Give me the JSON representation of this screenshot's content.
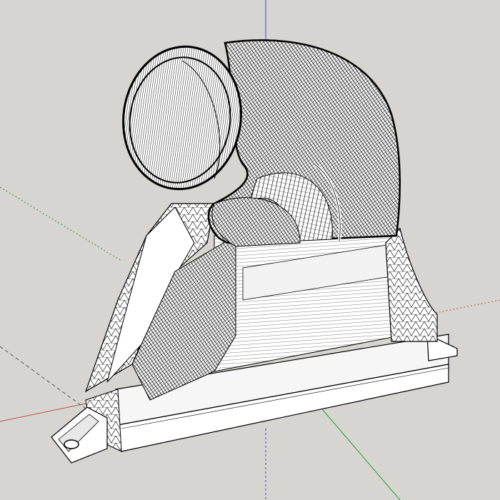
{
  "viewport": {
    "background": "#d6d5d1"
  },
  "axes": {
    "red": "#c0504d",
    "green": "#2e9a3a",
    "blue": "#4a4ad0",
    "dashed_color": "#555555"
  },
  "model": {
    "face_color": "#ffffff",
    "shade_color": "#efefef",
    "edge_color": "#000000",
    "mesh_density": "high"
  }
}
